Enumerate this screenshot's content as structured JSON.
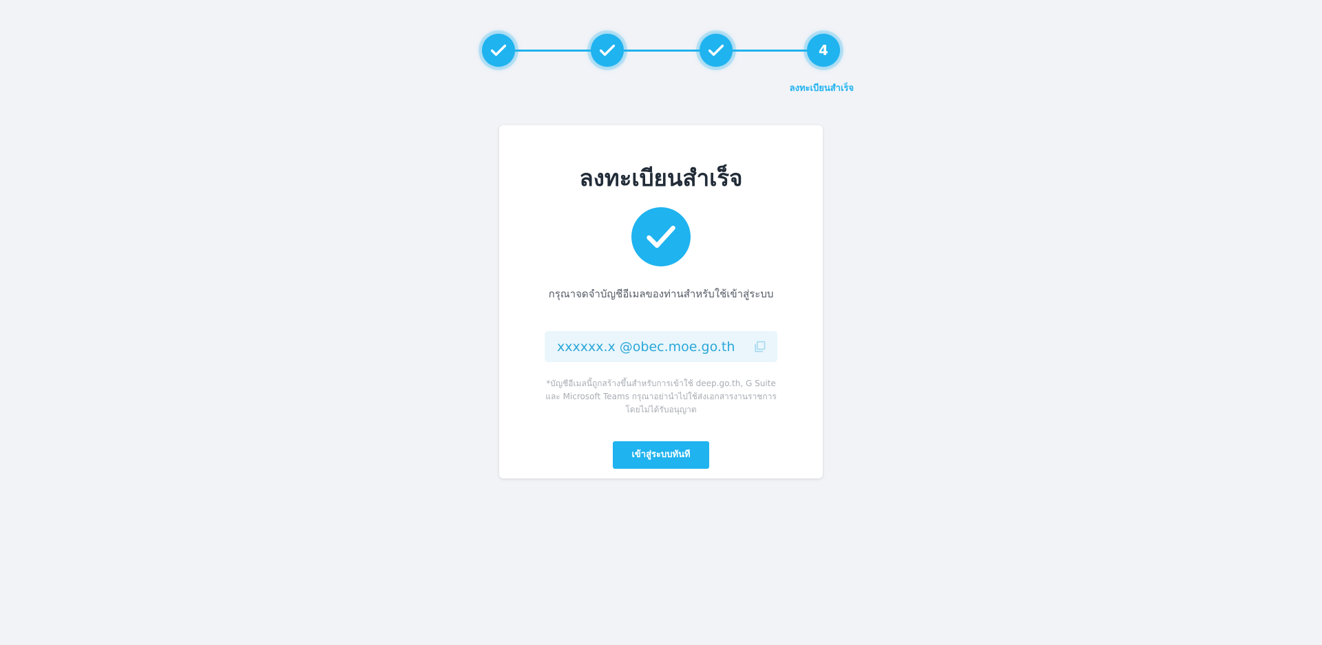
{
  "stepper": {
    "steps": [
      {
        "state": "done",
        "icon": "check-icon"
      },
      {
        "state": "done",
        "icon": "check-icon"
      },
      {
        "state": "done",
        "icon": "check-icon"
      },
      {
        "state": "current",
        "number": "4",
        "label": "ลงทะเบียนสำเร็จ"
      }
    ]
  },
  "card": {
    "title": "ลงทะเบียนสำเร็จ",
    "success_icon": "check-circle-icon",
    "instruction": "กรุณาจดจำบัญชีอีเมลของท่านสำหรับใช้เข้าสู่ระบบ",
    "email": "xxxxxx.x @obec.moe.go.th",
    "copy_icon": "copy-icon",
    "note": "*บัญชีอีเมลนี้ถูกสร้างขึ้นสำหรับการเข้าใช้ deep.go.th, G Suite และ Microsoft Teams กรุณาอย่านำไปใช้ส่งเอกสารงานราชการโดยไม่ได้รับอนุญาต",
    "login_button": "เข้าสู่ระบบทันที"
  },
  "colors": {
    "accent": "#1fb3ef",
    "background": "#f2f3f7",
    "email_bg": "#eaf6fc"
  }
}
